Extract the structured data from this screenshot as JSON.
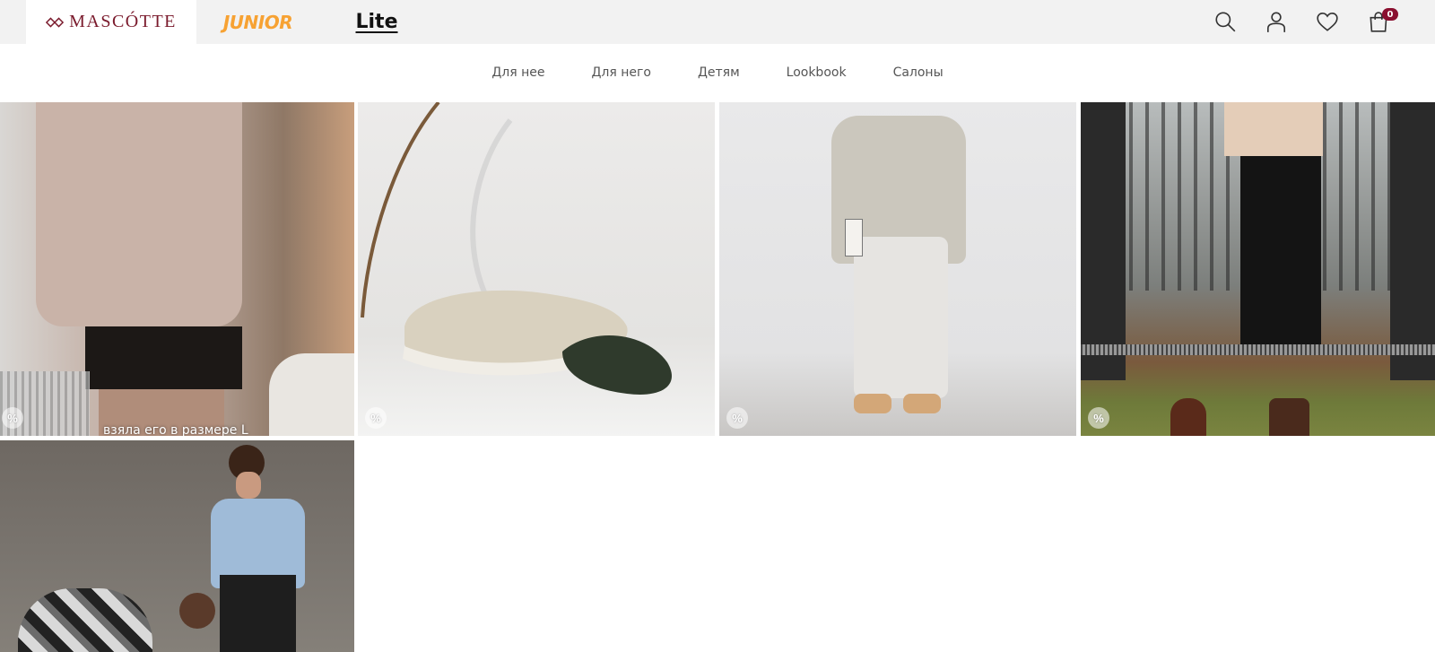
{
  "header": {
    "brands": [
      "MASCÓTTE",
      "JUNIOR",
      "Lite"
    ],
    "icons": [
      "search-icon",
      "user-icon",
      "heart-icon",
      "cart-icon"
    ],
    "cart_count": "0",
    "colors": {
      "mascotte": "#7a1a2c",
      "junior": "#f7a233",
      "badge": "#8a1030"
    }
  },
  "nav": {
    "items": [
      "Для нее",
      "Для него",
      "Детям",
      "Lookbook",
      "Салоны"
    ]
  },
  "tiles": [
    {
      "badge": "%",
      "caption": "взяла его в размере L"
    },
    {
      "badge": "%"
    },
    {
      "badge": "%"
    },
    {
      "badge": "%"
    },
    {}
  ]
}
